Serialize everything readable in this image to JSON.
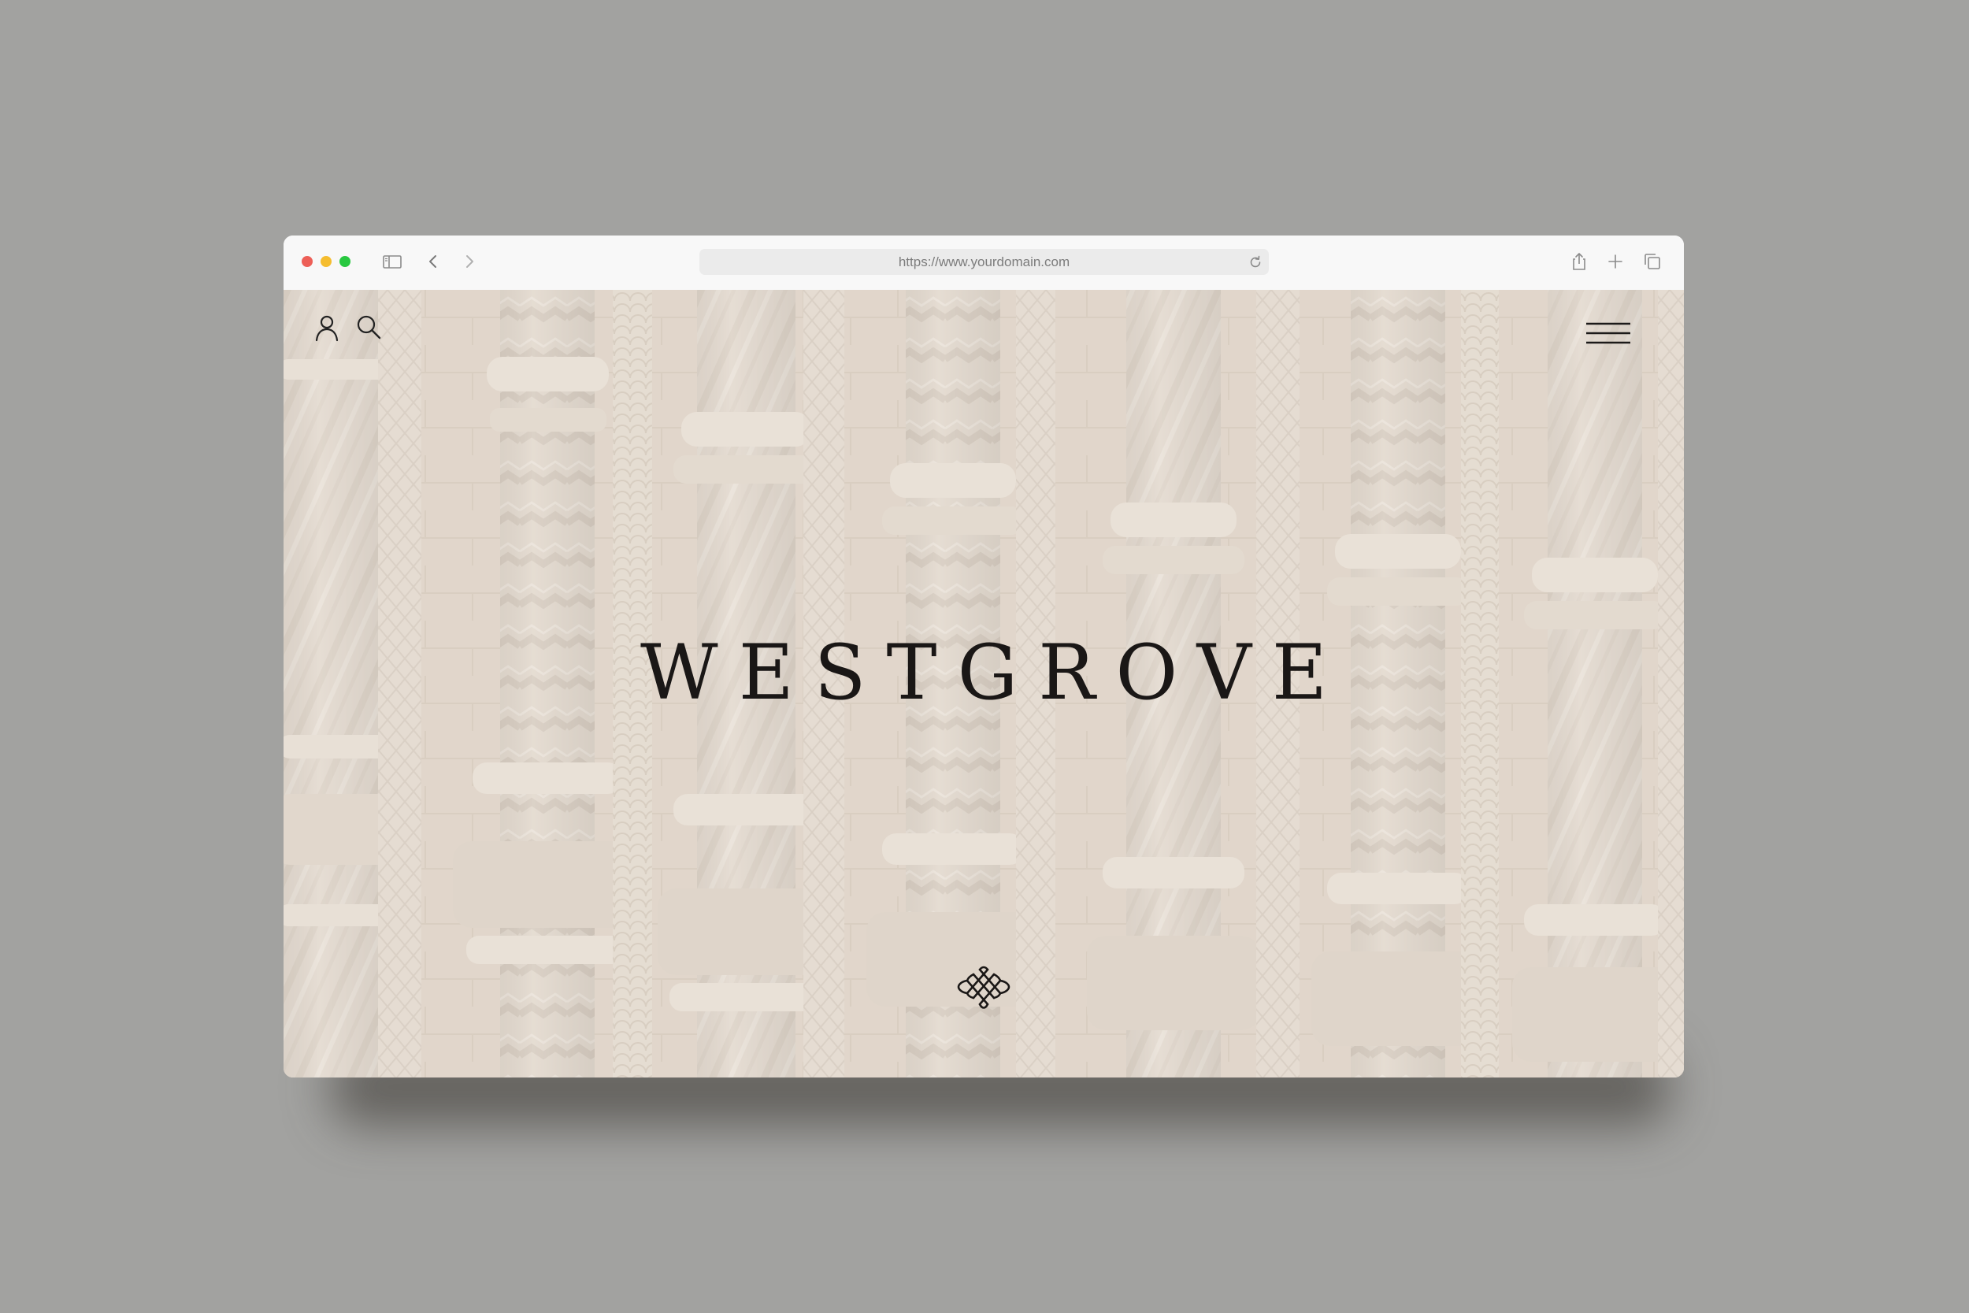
{
  "browser": {
    "url": "https://www.yourdomain.com",
    "traffic_lights": {
      "close_color": "#ed5f57",
      "minimize_color": "#f5bd2f",
      "maximize_color": "#28c840"
    },
    "icons": [
      "sidebar-icon",
      "back-icon",
      "forward-icon",
      "reload-icon",
      "share-icon",
      "new-tab-icon",
      "tabs-overview-icon"
    ]
  },
  "site": {
    "brand_name": "WESTGROVE",
    "header_icons": [
      "user-icon",
      "search-icon",
      "hamburger-menu-icon"
    ],
    "emblem": "knot-emblem-icon",
    "hero_background": "carved-stone-columns",
    "colors": {
      "background_tint": "#e5dbd1",
      "text": "#1a1716"
    }
  }
}
